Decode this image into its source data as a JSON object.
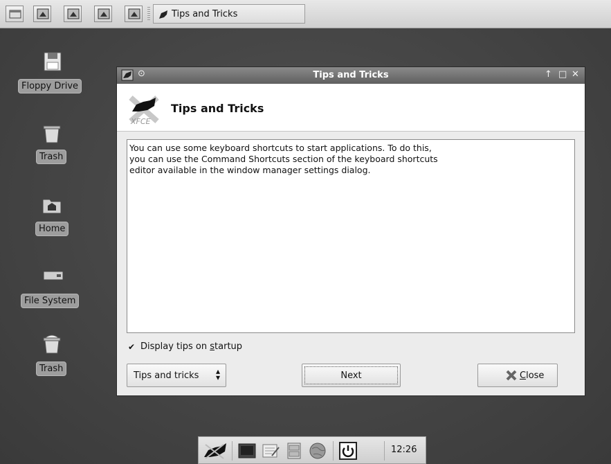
{
  "top_panel": {
    "task_button_label": "Tips and Tricks"
  },
  "desktop_icons": [
    {
      "label": "Floppy Drive"
    },
    {
      "label": "Trash"
    },
    {
      "label": "Home"
    },
    {
      "label": "File System"
    },
    {
      "label": "Trash"
    }
  ],
  "dialog": {
    "window_title": "Tips and Tricks",
    "header_title": "Tips and Tricks",
    "tip_text": "You can use some keyboard shortcuts to start applications. To do this,\nyou can use the Command Shortcuts section of the keyboard shortcuts\neditor available in the window manager settings dialog.",
    "checkbox_checked": true,
    "checkbox_label_before": "Display tips on ",
    "checkbox_label_mnemonic": "s",
    "checkbox_label_after": "tartup",
    "combo_value": "Tips and tricks",
    "next_label": "Next",
    "close_label_mnemonic": "C",
    "close_label_rest": "lose"
  },
  "dock": {
    "clock": "12:26"
  }
}
